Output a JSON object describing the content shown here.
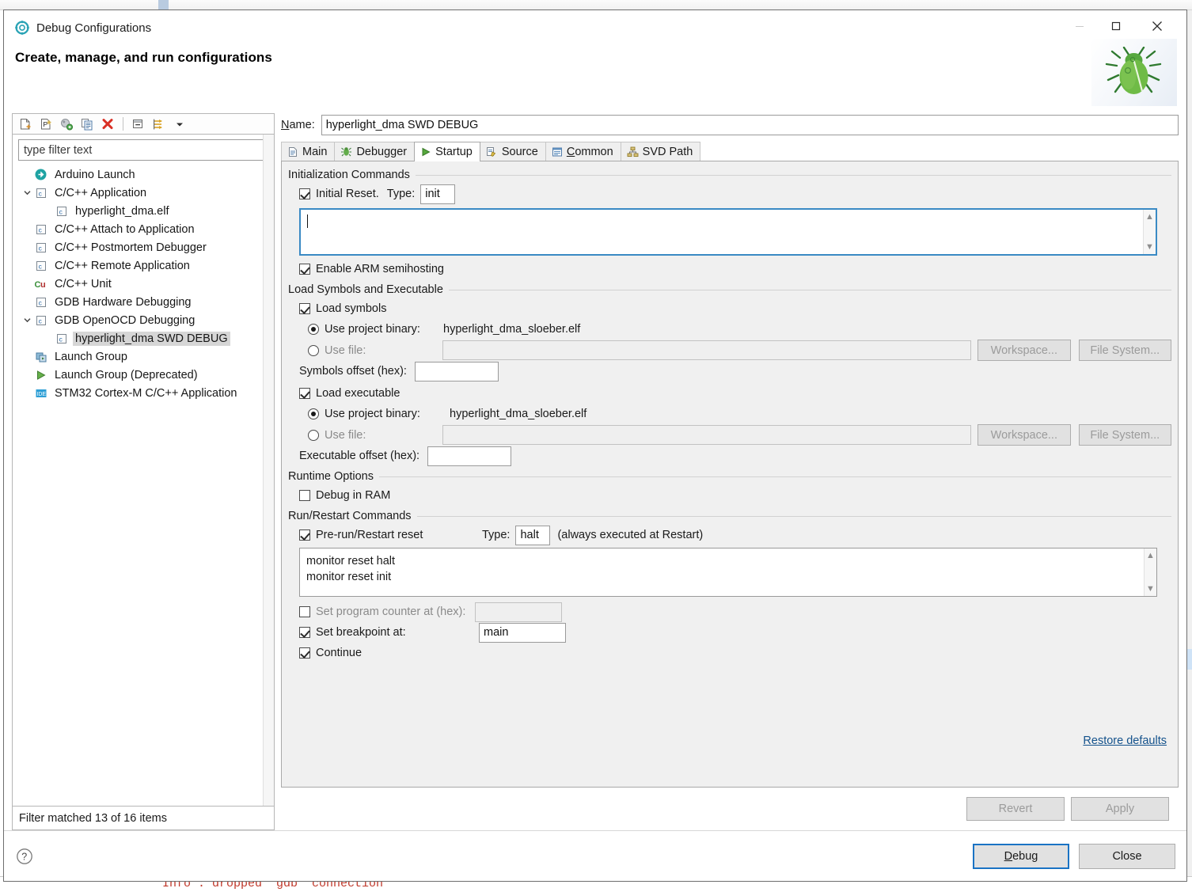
{
  "background": {
    "console_line": "Info : dropped 'gdb' connection"
  },
  "window": {
    "title": "Debug Configurations",
    "icon": "debug-configurations-icon",
    "minimize_label": "─",
    "maximize_label": "□",
    "close_label": "✕"
  },
  "header": {
    "title": "Create, manage, and run configurations",
    "banner_icon": "green-bug-icon"
  },
  "tree_toolbar": {
    "buttons": [
      {
        "name": "new-launch-configuration-icon",
        "tooltip": "New launch configuration"
      },
      {
        "name": "new-prototype-icon",
        "tooltip": "New prototype"
      },
      {
        "name": "export-launch-configuration-icon",
        "tooltip": "Export"
      },
      {
        "name": "duplicate-icon",
        "tooltip": "Duplicate"
      },
      {
        "name": "delete-icon",
        "tooltip": "Delete"
      },
      {
        "name": "collapse-all-icon",
        "tooltip": "Collapse All"
      },
      {
        "name": "filter-launch-configurations-icon",
        "tooltip": "Filter"
      },
      {
        "name": "view-menu-chevron-icon",
        "tooltip": "View Menu"
      }
    ]
  },
  "filter": {
    "value": "",
    "placeholder": "type filter text",
    "status": "Filter matched 13 of 16 items"
  },
  "tree": {
    "items": [
      {
        "label": "Arduino Launch",
        "indent": 1,
        "icon": "arduino-icon",
        "twisty": "",
        "selected": false
      },
      {
        "label": "C/C++ Application",
        "indent": 1,
        "icon": "c-file-icon",
        "twisty": "expanded",
        "selected": false
      },
      {
        "label": "hyperlight_dma.elf",
        "indent": 3,
        "icon": "c-file-icon",
        "twisty": "",
        "selected": false
      },
      {
        "label": "C/C++ Attach to Application",
        "indent": 2,
        "icon": "c-file-icon",
        "twisty": "",
        "selected": false
      },
      {
        "label": "C/C++ Postmortem Debugger",
        "indent": 2,
        "icon": "c-file-icon",
        "twisty": "",
        "selected": false
      },
      {
        "label": "C/C++ Remote Application",
        "indent": 2,
        "icon": "c-file-icon",
        "twisty": "",
        "selected": false
      },
      {
        "label": "C/C++ Unit",
        "indent": 2,
        "icon": "cunit-icon",
        "twisty": "",
        "selected": false
      },
      {
        "label": "GDB Hardware Debugging",
        "indent": 2,
        "icon": "c-file-icon",
        "twisty": "",
        "selected": false
      },
      {
        "label": "GDB OpenOCD Debugging",
        "indent": 1,
        "icon": "c-file-icon",
        "twisty": "expanded",
        "selected": false
      },
      {
        "label": "hyperlight_dma SWD DEBUG",
        "indent": 3,
        "icon": "c-file-icon",
        "twisty": "",
        "selected": true
      },
      {
        "label": "Launch Group",
        "indent": 2,
        "icon": "launch-group-icon",
        "twisty": "",
        "selected": false
      },
      {
        "label": "Launch Group (Deprecated)",
        "indent": 2,
        "icon": "run-green-icon",
        "twisty": "",
        "selected": false
      },
      {
        "label": "STM32 Cortex-M C/C++ Application",
        "indent": 2,
        "icon": "stm32-ide-icon",
        "twisty": "",
        "selected": false
      }
    ]
  },
  "name_field": {
    "label": "Name:",
    "underlined_letter": "N",
    "value": "hyperlight_dma SWD DEBUG"
  },
  "tabs": [
    {
      "label": "Main",
      "icon": "main-page-icon",
      "active": false,
      "mnemonic": ""
    },
    {
      "label": "Debugger",
      "icon": "debugger-bug-icon",
      "active": false,
      "mnemonic": ""
    },
    {
      "label": "Startup",
      "icon": "startup-run-icon",
      "active": true,
      "mnemonic": ""
    },
    {
      "label": "Source",
      "icon": "source-pencil-icon",
      "active": false,
      "mnemonic": ""
    },
    {
      "label": "Common",
      "icon": "common-window-icon",
      "active": false,
      "mnemonic": "C"
    },
    {
      "label": "SVD Path",
      "icon": "svd-tree-icon",
      "active": false,
      "mnemonic": ""
    }
  ],
  "startup": {
    "init_group": {
      "title": "Initialization Commands",
      "initial_reset": {
        "label": "Initial Reset.",
        "checked": true
      },
      "type_label": "Type:",
      "type_value": "init",
      "commands_value": "",
      "focused": true,
      "semihosting": {
        "label": "Enable ARM semihosting",
        "checked": true
      }
    },
    "load_group": {
      "title": "Load Symbols and Executable",
      "load_symbols": {
        "label": "Load symbols",
        "checked": true
      },
      "symbols_project_binary": {
        "label": "Use project binary:",
        "value": "hyperlight_dma_sloeber.elf",
        "selected": true
      },
      "symbols_use_file": {
        "label": "Use file:",
        "value": "",
        "selected": false
      },
      "symbols_offset_label": "Symbols offset (hex):",
      "symbols_offset_value": "",
      "load_executable": {
        "label": "Load executable",
        "checked": true
      },
      "exec_project_binary": {
        "label": "Use project binary:",
        "value": "hyperlight_dma_sloeber.elf",
        "selected": true
      },
      "exec_use_file": {
        "label": "Use file:",
        "value": "",
        "selected": false
      },
      "exec_offset_label": "Executable offset (hex):",
      "exec_offset_value": "",
      "workspace_button": "Workspace...",
      "filesystem_button": "File System..."
    },
    "runtime_group": {
      "title": "Runtime Options",
      "debug_in_ram": {
        "label": "Debug in RAM",
        "checked": false
      }
    },
    "run_group": {
      "title": "Run/Restart Commands",
      "prerun_reset": {
        "label": "Pre-run/Restart reset",
        "checked": true
      },
      "type_label": "Type:",
      "type_value": "halt",
      "type_note": "(always executed at Restart)",
      "commands_value": "monitor reset halt\nmonitor reset init",
      "set_pc": {
        "label": "Set program counter at (hex):",
        "checked": false,
        "value": ""
      },
      "set_breakpoint": {
        "label": "Set breakpoint at:",
        "checked": true,
        "value": "main"
      },
      "continue": {
        "label": "Continue",
        "checked": true
      }
    },
    "restore_defaults": "Restore defaults"
  },
  "apply_bar": {
    "revert": "Revert",
    "revert_mnemonic": "v",
    "apply": "Apply",
    "apply_mnemonic": "y"
  },
  "footer": {
    "help_icon": "help-question-icon",
    "debug": "Debug",
    "debug_mnemonic": "D",
    "close": "Close"
  },
  "colors": {
    "accent_blue": "#1a73c4",
    "link_blue": "#14528c",
    "focus_border": "#3a8ac4",
    "selection_gray": "#d6d6d6",
    "delete_red": "#d93025",
    "bug_green": "#3c9b3c"
  }
}
